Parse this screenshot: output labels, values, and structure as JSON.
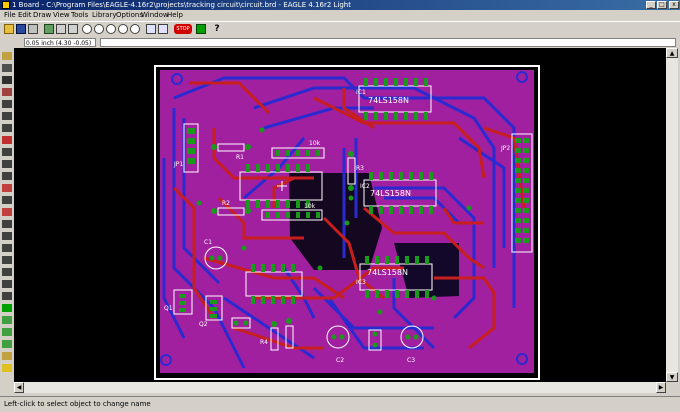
{
  "window": {
    "title": "1 Board - C:\\Program Files\\EAGLE-4.16r2\\projects\\tracking circuit\\circuit.brd - EAGLE 4.16r2 Light",
    "min_glyph": "_",
    "max_glyph": "□",
    "close_glyph": "x"
  },
  "menu": [
    "File",
    "Edit",
    "Draw",
    "View",
    "Tools",
    "Library",
    "Options",
    "Window",
    "Help"
  ],
  "toolbar": {
    "icons": [
      "open-icon",
      "save-icon",
      "print-icon",
      "cam-icon",
      "zoom-fit-icon",
      "zoom-in-icon",
      "zoom-out-icon",
      "zoom-redraw-icon",
      "zoom-select-icon",
      "undo-icon",
      "redo-icon",
      "stop-icon",
      "go-icon",
      "help-icon"
    ],
    "stop_label": "STOP",
    "help_label": "?"
  },
  "command": {
    "coordinate": "0.05 inch (4.30 -0.05)",
    "input_value": ""
  },
  "board": {
    "labels": {
      "ic_a": "74LS158N",
      "ic_b": "74LS158N",
      "ic_c": "74LS158N",
      "ic_a_ref": "IC1",
      "ic_b_ref": "IC2",
      "ic_c_ref": "IC3",
      "r1": "R1",
      "r2": "R2",
      "r3": "R3",
      "r4": "R4",
      "res_10k_a": "10k",
      "res_10k_b": "10k",
      "c1": "C1",
      "c2": "C2",
      "c3": "C3",
      "jp_left": "JP1",
      "jp_right": "JP2",
      "q_left": "Q1",
      "q_right": "Q2"
    },
    "colors": {
      "board": "#a020a0",
      "top_layer": "#c81e1e",
      "bottom_layer": "#2a2ad0",
      "pad": "#1a9a1a",
      "outline": "#ffffff",
      "background": "#000000"
    }
  },
  "status": {
    "text": "Left-click to select object to change name"
  }
}
